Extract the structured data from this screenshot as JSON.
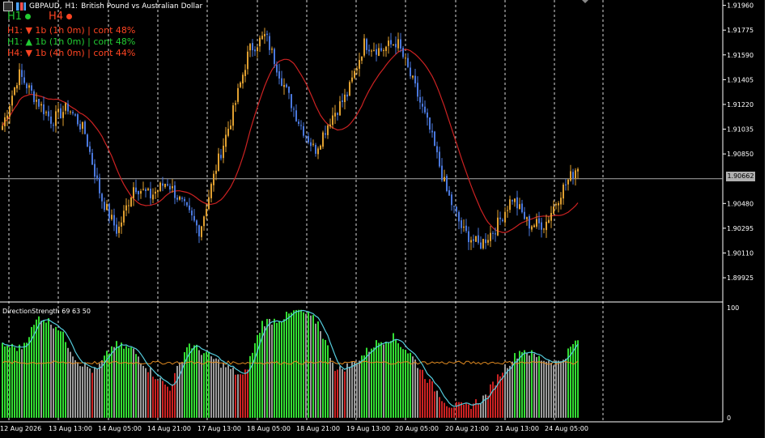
{
  "header": {
    "symbol": "GBPAUD,",
    "timeframe": "H1:",
    "description": "British Pound vs Australian Dollar"
  },
  "timeframes": [
    {
      "label": "H1",
      "color": "#22cc33"
    },
    {
      "label": "H4",
      "color": "#ff4422"
    }
  ],
  "signals": [
    {
      "text": "H1: ▼ 1b (1h 0m) | cont 48%",
      "color": "#ff4422"
    },
    {
      "text": "H1: ▲ 1b (1h 0m) | cont 48%",
      "color": "#22cc33"
    },
    {
      "text": "H4: ▼ 1b (4h 0m) | cont 44%",
      "color": "#ff4422"
    }
  ],
  "indicator": {
    "label": "DirectionStrength 69 63 50"
  },
  "current_price": "1.90662",
  "colors": {
    "bull": "#e0a030",
    "bear": "#4a78dd",
    "ma": "#cc2222",
    "grid": "#ffffff",
    "osc_green": "#33dd33",
    "osc_red": "#cc2222",
    "osc_gray": "#9a9a9a",
    "osc_line": "#55ccdd",
    "osc_level": "#e08a20"
  },
  "chart_data": [
    {
      "type": "candlestick",
      "ylim": [
        1.8975,
        1.92
      ],
      "price_ticks": [
        "1.91960",
        "1.91775",
        "1.91590",
        "1.91405",
        "1.91220",
        "1.91035",
        "1.90850",
        "1.90662",
        "1.90480",
        "1.90295",
        "1.90110",
        "1.89925"
      ],
      "tick_values": [
        1.9196,
        1.91775,
        1.9159,
        1.91405,
        1.9122,
        1.91035,
        1.9085,
        1.90665,
        1.9048,
        1.90295,
        1.9011,
        1.89925
      ],
      "x_labels": [
        "12 Aug 2026",
        "13 Aug 13:00",
        "14 Aug 05:00",
        "14 Aug 21:00",
        "17 Aug 13:00",
        "18 Aug 05:00",
        "18 Aug 21:00",
        "19 Aug 13:00",
        "20 Aug 05:00",
        "20 Aug 21:00",
        "21 Aug 13:00",
        "24 Aug 05:00"
      ],
      "anchors": [
        [
          1.9102,
          1.911
        ],
        [
          1.9142,
          1.9148
        ],
        [
          1.9125,
          1.9128
        ],
        [
          1.9108,
          1.9112
        ],
        [
          1.9118,
          1.9122
        ],
        [
          1.9098,
          1.9105
        ],
        [
          1.905,
          1.9055
        ],
        [
          1.9025,
          1.9028
        ],
        [
          1.906,
          1.9063
        ],
        [
          1.9052,
          1.9055
        ],
        [
          1.9063,
          1.9066
        ],
        [
          1.9045,
          1.9048
        ],
        [
          1.903,
          1.9025
        ],
        [
          1.9072,
          1.9078
        ],
        [
          1.9112,
          1.9118
        ],
        [
          1.916,
          1.9165
        ],
        [
          1.9172,
          1.9175
        ],
        [
          1.9138,
          1.9142
        ],
        [
          1.9112,
          1.9108
        ],
        [
          1.9085,
          1.909
        ],
        [
          1.911,
          1.9115
        ],
        [
          1.9128,
          1.9132
        ],
        [
          1.9165,
          1.917
        ],
        [
          1.916,
          1.9165
        ],
        [
          1.917,
          1.9168
        ],
        [
          1.9135,
          1.914
        ],
        [
          1.91,
          1.9105
        ],
        [
          1.906,
          1.9055
        ],
        [
          1.903,
          1.9025
        ],
        [
          1.9015,
          1.9018
        ],
        [
          1.9028,
          1.9032
        ],
        [
          1.905,
          1.9055
        ],
        [
          1.9035,
          1.903
        ],
        [
          1.903,
          1.9035
        ],
        [
          1.9055,
          1.906
        ],
        [
          1.9075,
          1.9078
        ]
      ]
    },
    {
      "type": "oscillator",
      "ylim": [
        0,
        100
      ],
      "ticks": [
        "100",
        "0"
      ],
      "level": 50,
      "series": [],
      "anchors": [
        [
          62,
          70
        ],
        [
          60,
          66
        ],
        [
          90,
          95
        ],
        [
          80,
          85
        ],
        [
          50,
          55
        ],
        [
          40,
          43
        ],
        [
          65,
          68
        ],
        [
          60,
          64
        ],
        [
          40,
          44
        ],
        [
          25,
          28
        ],
        [
          65,
          70
        ],
        [
          55,
          60
        ],
        [
          45,
          49
        ],
        [
          35,
          38
        ],
        [
          85,
          88
        ],
        [
          88,
          92
        ],
        [
          96,
          100
        ],
        [
          85,
          88
        ],
        [
          40,
          45
        ],
        [
          48,
          52
        ],
        [
          65,
          68
        ],
        [
          72,
          76
        ],
        [
          55,
          60
        ],
        [
          30,
          35
        ],
        [
          10,
          14
        ],
        [
          8,
          11
        ],
        [
          18,
          20
        ],
        [
          42,
          48
        ],
        [
          60,
          65
        ],
        [
          52,
          55
        ],
        [
          48,
          52
        ],
        [
          68,
          75
        ]
      ]
    }
  ]
}
